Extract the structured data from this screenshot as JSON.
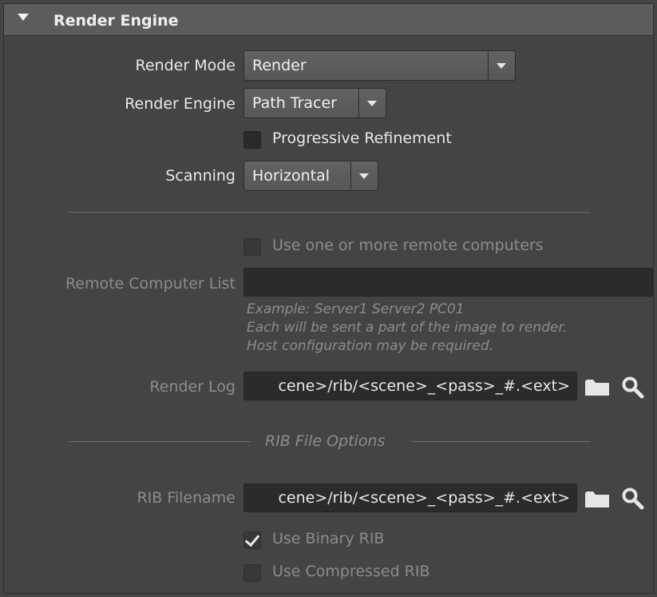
{
  "header": {
    "title": "Render Engine"
  },
  "render_mode": {
    "label": "Render Mode",
    "value": "Render"
  },
  "render_engine": {
    "label": "Render Engine",
    "value": "Path Tracer"
  },
  "progressive": {
    "label": "Progressive Refinement",
    "checked": false
  },
  "scanning": {
    "label": "Scanning",
    "value": "Horizontal"
  },
  "remote": {
    "use_label": "Use one or more remote computers",
    "checked": false,
    "list_label": "Remote Computer List",
    "list_value": "",
    "hint_lines": [
      "Example: Server1 Server2 PC01",
      "Each will be sent a part of the image to render.",
      "Host configuration may be required."
    ]
  },
  "render_log": {
    "label": "Render Log",
    "value": "cene>/rib/<scene>_<pass>_#.<ext>"
  },
  "rib_section": {
    "title": "RIB File Options"
  },
  "rib_filename": {
    "label": "RIB Filename",
    "value": "cene>/rib/<scene>_<pass>_#.<ext>"
  },
  "binary_rib": {
    "label": "Use Binary RIB",
    "checked": true
  },
  "compressed_rib": {
    "label": "Use Compressed RIB",
    "checked": false
  },
  "icons": [
    "folder-icon",
    "magnifier-icon"
  ]
}
